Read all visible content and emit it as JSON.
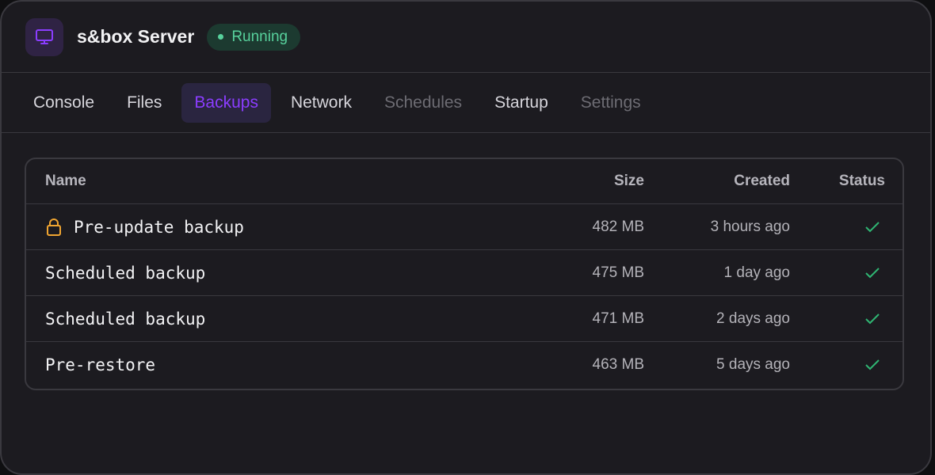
{
  "server": {
    "icon": "monitor-icon",
    "title": "s&box Server",
    "status": "Running",
    "status_color": "#57d19c"
  },
  "tabs": [
    {
      "label": "Console",
      "state": "normal"
    },
    {
      "label": "Files",
      "state": "normal"
    },
    {
      "label": "Backups",
      "state": "active"
    },
    {
      "label": "Network",
      "state": "normal"
    },
    {
      "label": "Schedules",
      "state": "disabled"
    },
    {
      "label": "Startup",
      "state": "normal"
    },
    {
      "label": "Settings",
      "state": "disabled"
    }
  ],
  "table": {
    "columns": {
      "name": "Name",
      "size": "Size",
      "created": "Created",
      "status": "Status"
    },
    "rows": [
      {
        "name": "Pre-update backup",
        "size": "482 MB",
        "created": "3 hours ago",
        "status": "check-icon",
        "locked": true
      },
      {
        "name": "Scheduled backup",
        "size": "475 MB",
        "created": "1 day ago",
        "status": "check-icon",
        "locked": false
      },
      {
        "name": "Scheduled backup",
        "size": "471 MB",
        "created": "2 days ago",
        "status": "check-icon",
        "locked": false
      },
      {
        "name": "Pre-restore",
        "size": "463 MB",
        "created": "5 days ago",
        "status": "check-icon",
        "locked": false
      }
    ]
  },
  "colors": {
    "accent": "#8b3dff",
    "lock": "#f0a531",
    "success": "#2fb673"
  }
}
